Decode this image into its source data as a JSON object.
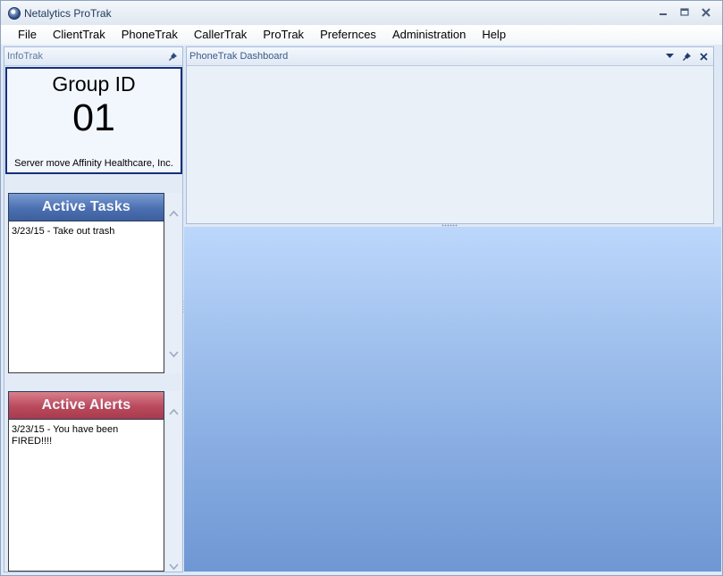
{
  "window": {
    "title": "Netalytics ProTrak"
  },
  "menu": {
    "items": [
      "File",
      "ClientTrak",
      "PhoneTrak",
      "CallerTrak",
      "ProTrak",
      "Prefernces",
      "Administration",
      "Help"
    ]
  },
  "infotrak": {
    "title": "InfoTrak",
    "group_label": "Group ID",
    "group_number": "01",
    "group_description": "Server move Affinity Healthcare, Inc."
  },
  "tasks": {
    "title": "Active Tasks",
    "items": [
      "3/23/15 - Take out trash"
    ]
  },
  "alerts": {
    "title": "Active Alerts",
    "items": [
      "3/23/15 - You have been FIRED!!!!"
    ]
  },
  "dashboard": {
    "title": "PhoneTrak Dashboard"
  },
  "icons": {
    "app": "app-logo-icon",
    "minimize": "minimize-icon",
    "maximize": "maximize-icon",
    "close": "close-icon",
    "pin": "pin-icon",
    "dropdown": "dropdown-arrow-icon",
    "scroll_up": "chevron-up-icon",
    "scroll_down": "chevron-down-icon"
  },
  "colors": {
    "tasks_header": "#4b6fb0",
    "alerts_header": "#b9495c",
    "group_border": "#152f7c",
    "main_gradient_top": "#bcd7fb",
    "main_gradient_bottom": "#6f97d3"
  }
}
